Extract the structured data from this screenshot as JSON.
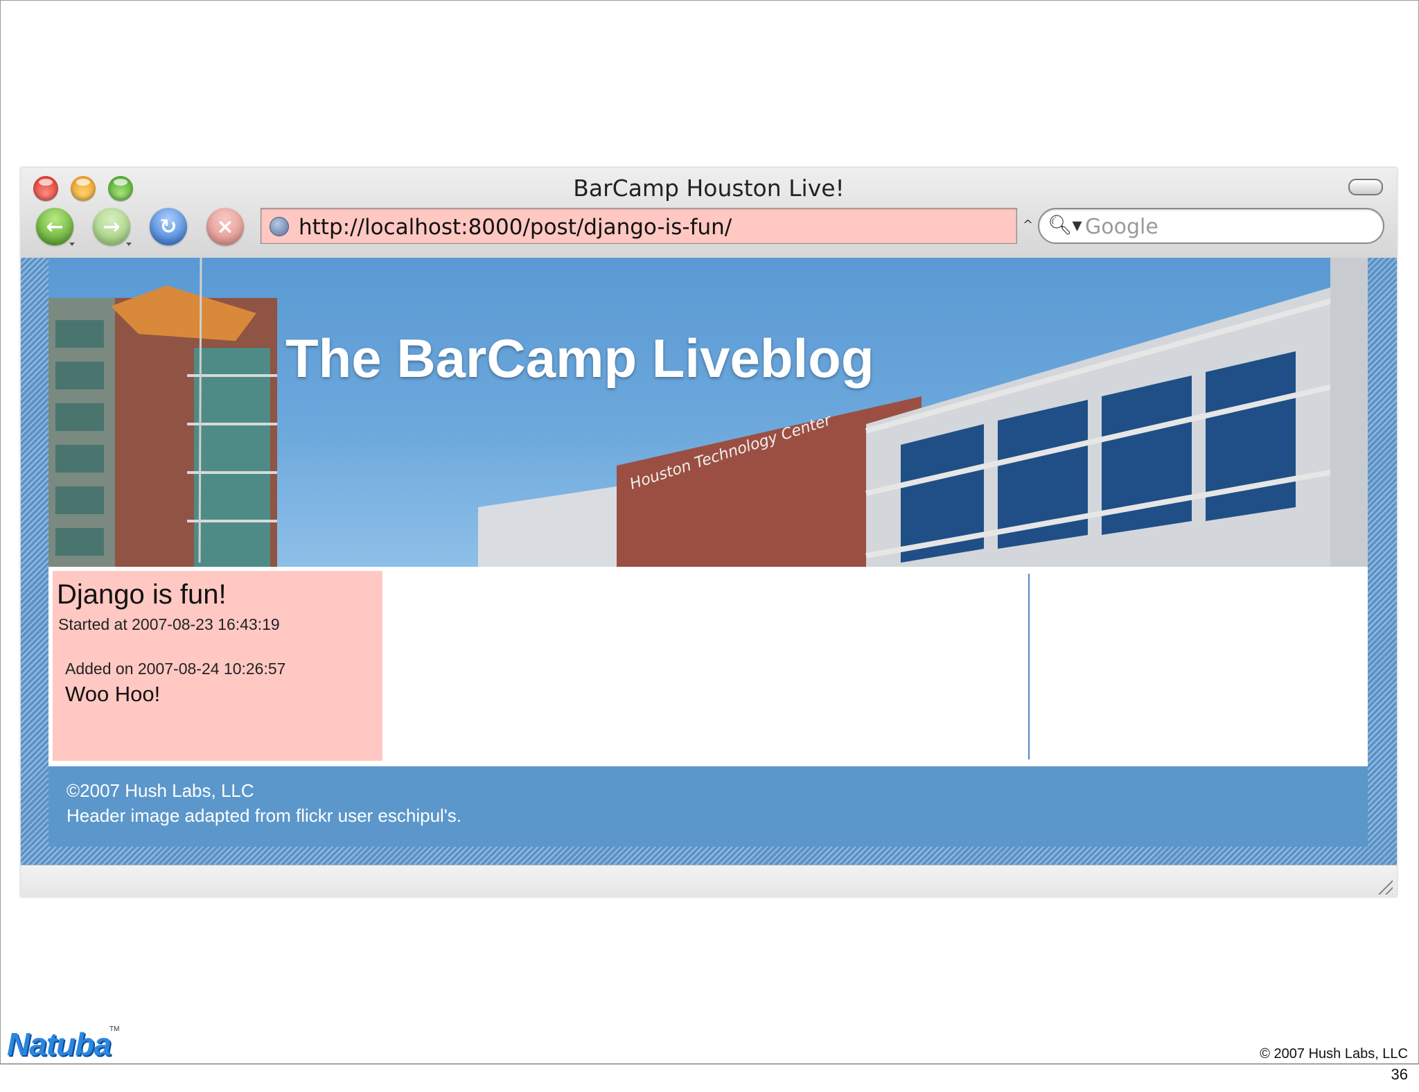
{
  "window": {
    "title": "BarCamp Houston Live!"
  },
  "toolbar": {
    "back_icon": "back-arrow-icon",
    "forward_icon": "forward-arrow-icon",
    "reload_icon": "reload-icon",
    "stop_icon": "stop-icon",
    "back_glyph": "←",
    "forward_glyph": "→",
    "reload_glyph": "↻",
    "stop_glyph": "×"
  },
  "address_bar": {
    "url": "http://localhost:8000/post/django-is-fun/",
    "background": "#ffc8c2"
  },
  "search": {
    "placeholder": "Google",
    "icon_glyph": "🔍︎▾"
  },
  "page": {
    "header_title": "The BarCamp Liveblog",
    "header_sign": "Houston Technology Center",
    "post": {
      "title": "Django is fun!",
      "started": "Started at 2007-08-23 16:43:19",
      "entries": [
        {
          "date": "Added on 2007-08-24 10:26:57",
          "text": "Woo Hoo!"
        }
      ]
    },
    "footer": {
      "line1": "©2007 Hush Labs, LLC",
      "line2": "Header image adapted from flickr user eschipul's."
    }
  },
  "slide": {
    "logo": "Natuba",
    "logo_tm": "TM",
    "copyright": "© 2007 Hush Labs, LLC",
    "number": "36"
  },
  "colors": {
    "accent_blue": "#5b97cb",
    "highlight_pink": "#ffc8c3"
  }
}
